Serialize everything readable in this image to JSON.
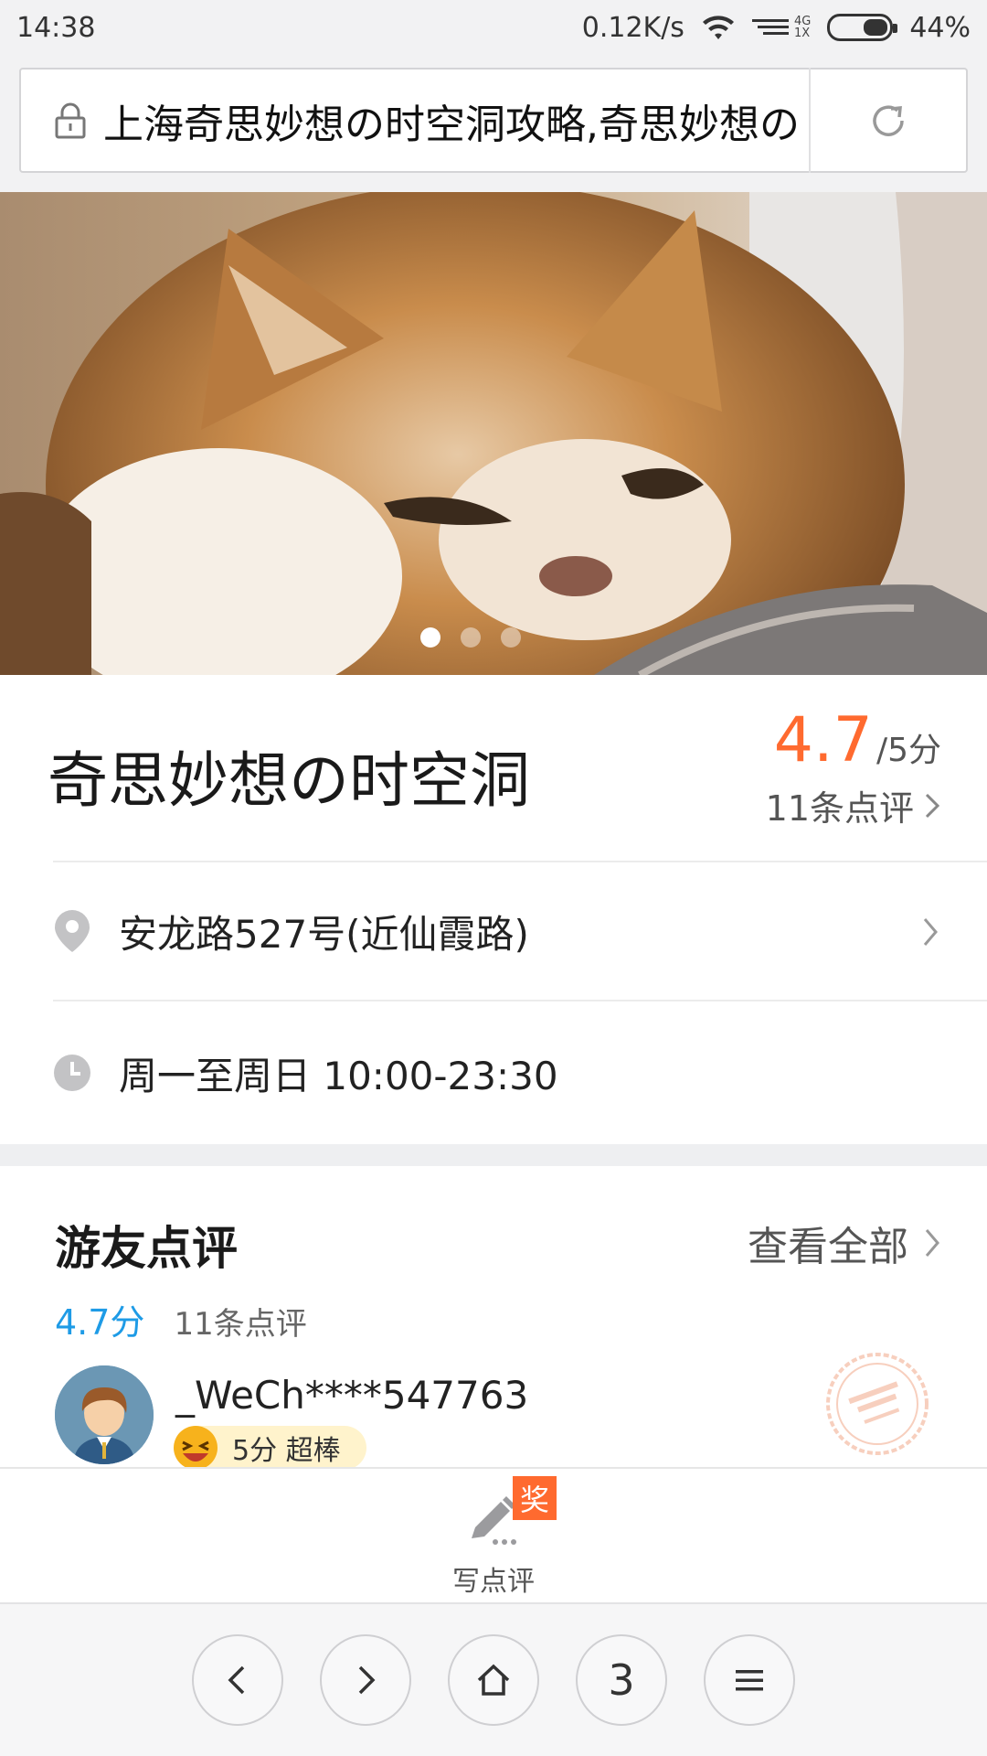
{
  "status_bar": {
    "time": "14:38",
    "speed": "0.12K/s",
    "net_top": "4G",
    "net_bottom": "1X",
    "battery": "44%"
  },
  "address_bar": {
    "url_text": "上海奇思妙想の时空洞攻略,奇思妙想の"
  },
  "hero": {
    "slide_count": 3,
    "active_slide": 1
  },
  "poi": {
    "title": "奇思妙想の时空洞",
    "rating": "4.7",
    "rating_max": "/5分",
    "review_count": "11条点评",
    "address": "安龙路527号(近仙霞路)",
    "hours": "周一至周日 10:00-23:30"
  },
  "reviews": {
    "title": "游友点评",
    "view_all": "查看全部",
    "score": "4.7分",
    "count": "11条点评",
    "first": {
      "name": "_WeCh****547763",
      "badge": "5分 超棒"
    }
  },
  "write_review": {
    "label": "写点评",
    "award": "奖"
  },
  "browser_nav": {
    "tab_count": "3"
  },
  "colors": {
    "rating_orange": "#ff6a2f",
    "score_blue": "#1e9be6",
    "badge_yellow": "#fff3cc"
  }
}
